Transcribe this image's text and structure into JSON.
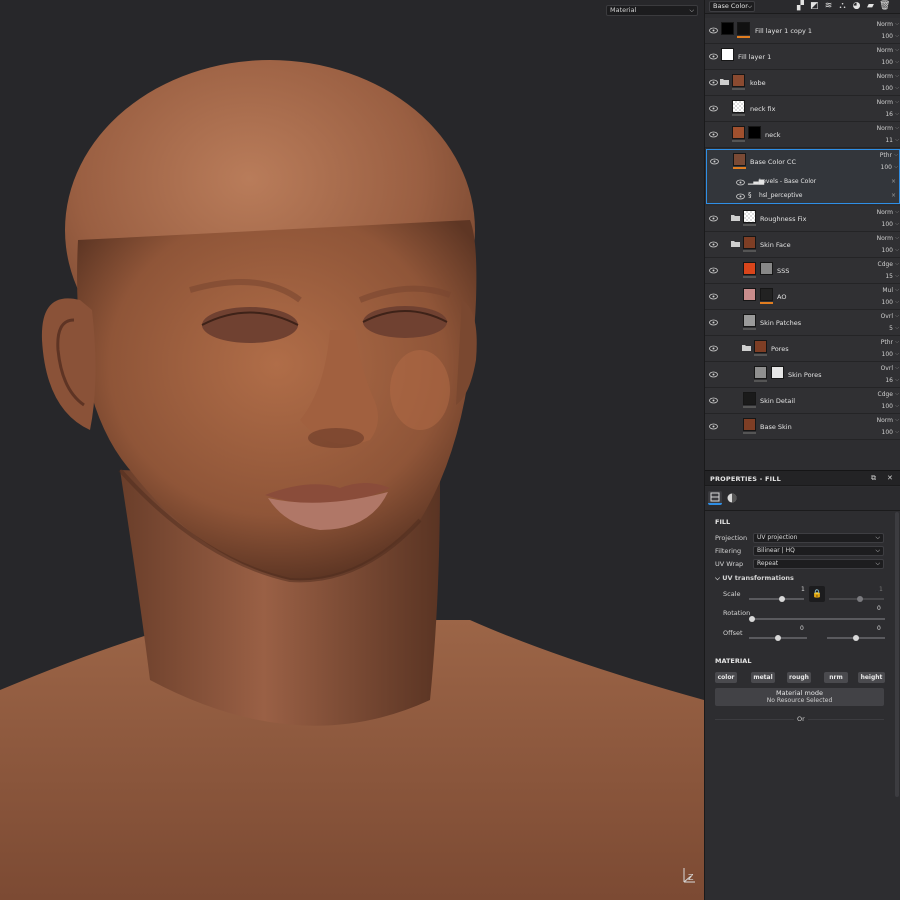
{
  "viewport": {
    "mode_select": "Material",
    "axis_label": "Z"
  },
  "topbar": {
    "channel": "Base Color",
    "tools": [
      "add-layer-icon",
      "add-mask-icon",
      "add-effect-icon",
      "paint-fill-icon",
      "add-fill-icon",
      "folder-icon",
      "delete-icon"
    ]
  },
  "layers": [
    {
      "name": "Fill layer 1 copy 1",
      "blend": "Norm",
      "opacity": "100"
    },
    {
      "name": "Fill layer 1",
      "blend": "Norm",
      "opacity": "100"
    },
    {
      "name": "kobe",
      "blend": "Norm",
      "opacity": "100"
    },
    {
      "name": "neck fix",
      "blend": "Norm",
      "opacity": "16"
    },
    {
      "name": "neck",
      "blend": "Norm",
      "opacity": "11"
    },
    {
      "name": "Base Color CC",
      "blend": "Pthr",
      "opacity": "100"
    },
    {
      "name": "Roughness Fix",
      "blend": "Norm",
      "opacity": "100"
    },
    {
      "name": "Skin Face",
      "blend": "Norm",
      "opacity": "100"
    },
    {
      "name": "SSS",
      "blend": "Cdge",
      "opacity": "15"
    },
    {
      "name": "AO",
      "blend": "Mul",
      "opacity": "100"
    },
    {
      "name": "Skin Patches",
      "blend": "Ovrl",
      "opacity": "5"
    },
    {
      "name": "Pores",
      "blend": "Pthr",
      "opacity": "100"
    },
    {
      "name": "Skin Pores",
      "blend": "Ovrl",
      "opacity": "16"
    },
    {
      "name": "Skin Detail",
      "blend": "Cdge",
      "opacity": "100"
    },
    {
      "name": "Base Skin",
      "blend": "Norm",
      "opacity": "100"
    }
  ],
  "effects": [
    {
      "name": "Levels - Base Color"
    },
    {
      "name": "hsl_perceptive"
    }
  ],
  "properties": {
    "title": "PROPERTIES - FILL",
    "fill_section": "FILL",
    "projection_label": "Projection",
    "projection_value": "UV projection",
    "filtering_label": "Filtering",
    "filtering_value": "Bilinear | HQ",
    "uvwrap_label": "UV Wrap",
    "uvwrap_value": "Repeat",
    "uvtrans_label": "UV transformations",
    "scale_label": "Scale",
    "scale_u": "1",
    "scale_v": "1",
    "rotation_label": "Rotation",
    "rotation_value": "0",
    "offset_label": "Offset",
    "offset_u": "0",
    "offset_v": "0",
    "material_section": "MATERIAL",
    "channels": [
      "color",
      "metal",
      "rough",
      "nrm",
      "height"
    ],
    "material_mode_label": "Material mode",
    "material_mode_value": "No Resource Selected",
    "or_label": "Or"
  }
}
